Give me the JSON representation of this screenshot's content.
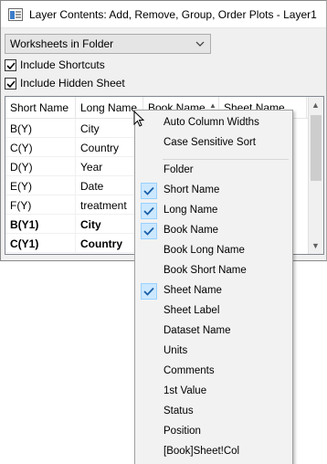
{
  "window": {
    "title": "Layer Contents: Add, Remove, Group, Order Plots - Layer1",
    "icon": "window-app-icon"
  },
  "filter_combo": {
    "selected": "Worksheets in Folder",
    "arrow": "⌵"
  },
  "checkboxes": {
    "include_shortcuts": {
      "label": "Include Shortcuts",
      "checked": true
    },
    "include_hidden_sheet": {
      "label": "Include Hidden Sheet",
      "checked": true
    }
  },
  "grid": {
    "columns": [
      "Short Name",
      "Long Name",
      "Book Name",
      "Sheet Name"
    ],
    "sort_indicator": "▲",
    "rows": [
      {
        "short": "B(Y)",
        "long": "City",
        "bold": false
      },
      {
        "short": "C(Y)",
        "long": "Country",
        "bold": false
      },
      {
        "short": "D(Y)",
        "long": "Year",
        "bold": false
      },
      {
        "short": "E(Y)",
        "long": "Date",
        "bold": false
      },
      {
        "short": "F(Y)",
        "long": "treatment",
        "bold": false
      },
      {
        "short": "B(Y1)",
        "long": "City",
        "bold": true
      },
      {
        "short": "C(Y1)",
        "long": "Country",
        "bold": true
      }
    ],
    "scroll_up": "▲",
    "scroll_down": "▼"
  },
  "context_menu": {
    "top_items": [
      "Auto Column Widths",
      "Case Sensitive Sort"
    ],
    "items": [
      {
        "label": "Folder",
        "checked": false
      },
      {
        "label": "Short Name",
        "checked": true
      },
      {
        "label": "Long Name",
        "checked": true
      },
      {
        "label": "Book Name",
        "checked": true
      },
      {
        "label": "Book Long Name",
        "checked": false
      },
      {
        "label": "Book Short Name",
        "checked": false
      },
      {
        "label": "Sheet Name",
        "checked": true
      },
      {
        "label": "Sheet Label",
        "checked": false
      },
      {
        "label": "Dataset Name",
        "checked": false
      },
      {
        "label": "Units",
        "checked": false
      },
      {
        "label": "Comments",
        "checked": false
      },
      {
        "label": "1st Value",
        "checked": false
      },
      {
        "label": "Status",
        "checked": false
      },
      {
        "label": "Position",
        "checked": false
      },
      {
        "label": "[Book]Sheet!Col",
        "checked": false
      }
    ]
  },
  "colors": {
    "check_highlight": "#cce8ff",
    "check_border": "#99d1ff",
    "check_mark": "#1a5fa8"
  }
}
